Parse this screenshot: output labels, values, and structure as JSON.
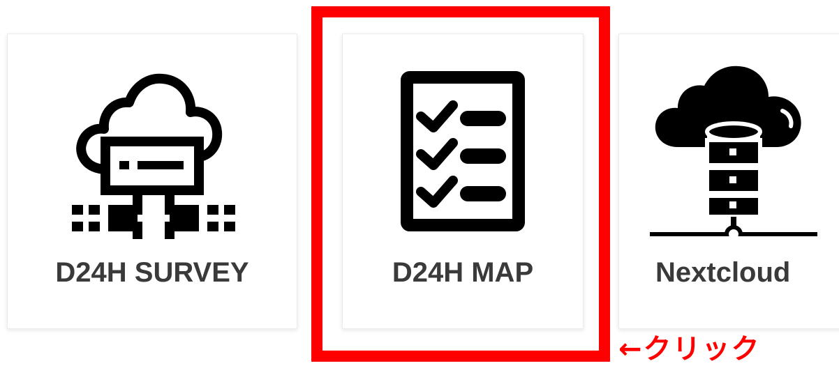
{
  "cards": [
    {
      "label": "D24H SURVEY",
      "icon": "cloud-server-icon"
    },
    {
      "label": "D24H MAP",
      "icon": "checklist-icon"
    },
    {
      "label": "Nextcloud",
      "icon": "cloud-database-icon"
    }
  ],
  "annotation": {
    "text": "←クリック",
    "color": "#ff0000"
  },
  "highlight_color": "#ff0000",
  "label_color": "#3a3a3a"
}
